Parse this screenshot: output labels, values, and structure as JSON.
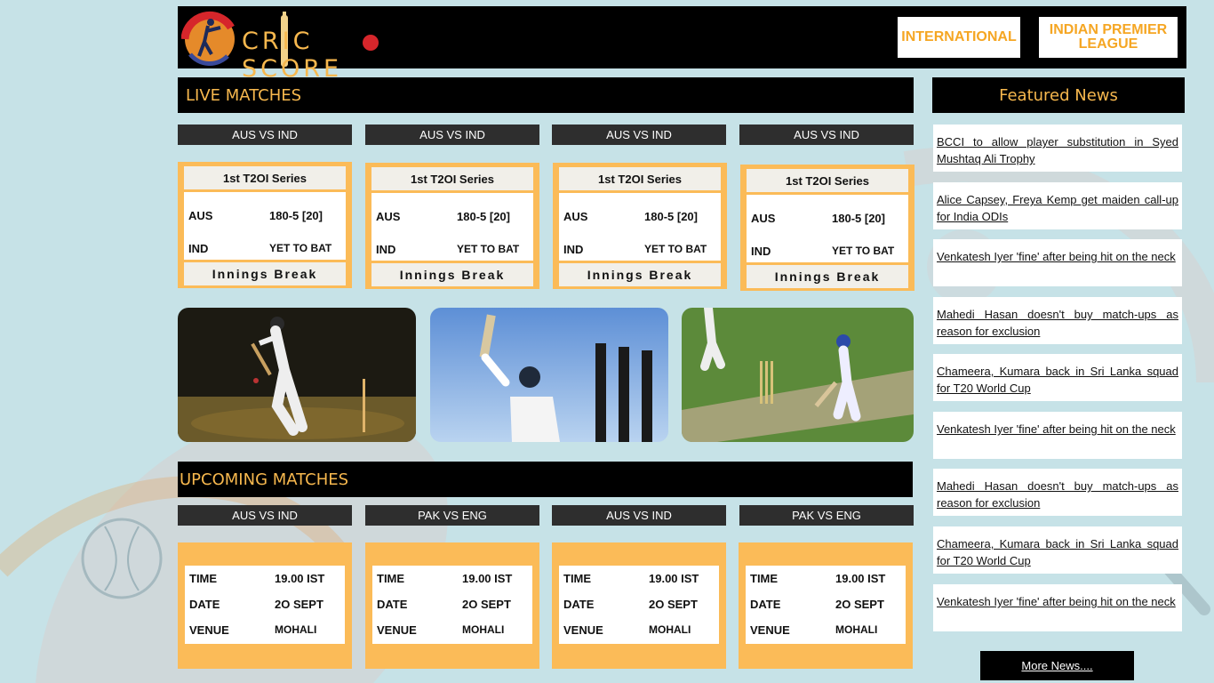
{
  "header": {
    "logo_text": "CRIC SCORE",
    "nav": [
      "INTERNATIONAL",
      "INDIAN PREMIER LEAGUE"
    ]
  },
  "live": {
    "title": "LIVE MATCHES",
    "matches": [
      {
        "teams": "AUS VS IND",
        "series": "1st T2OI Series",
        "team1": "AUS",
        "score1": "180-5 [20]",
        "team2": "IND",
        "score2": "YET TO BAT",
        "status": "Innings Break"
      },
      {
        "teams": "AUS VS IND",
        "series": "1st T2OI Series",
        "team1": "AUS",
        "score1": "180-5 [20]",
        "team2": "IND",
        "score2": "YET TO BAT",
        "status": "Innings Break"
      },
      {
        "teams": "AUS VS IND",
        "series": "1st T2OI Series",
        "team1": "AUS",
        "score1": "180-5 [20]",
        "team2": "IND",
        "score2": "YET TO BAT",
        "status": "Innings Break"
      },
      {
        "teams": "AUS VS IND",
        "series": "1st T2OI Series",
        "team1": "AUS",
        "score1": "180-5 [20]",
        "team2": "IND",
        "score2": "YET TO BAT",
        "status": "Innings Break"
      }
    ]
  },
  "upcoming": {
    "title": "UPCOMING MATCHES",
    "matches": [
      {
        "teams": "AUS VS IND",
        "time_label": "TIME",
        "time": "19.00 IST",
        "date_label": "DATE",
        "date": "2O SEPT",
        "venue_label": "VENUE",
        "venue": "MOHALI"
      },
      {
        "teams": "PAK VS ENG",
        "time_label": "TIME",
        "time": "19.00 IST",
        "date_label": "DATE",
        "date": "2O SEPT",
        "venue_label": "VENUE",
        "venue": "MOHALI"
      },
      {
        "teams": "AUS VS IND",
        "time_label": "TIME",
        "time": "19.00 IST",
        "date_label": "DATE",
        "date": "2O SEPT",
        "venue_label": "VENUE",
        "venue": "MOHALI"
      },
      {
        "teams": "PAK VS ENG",
        "time_label": "TIME",
        "time": "19.00 IST",
        "date_label": "DATE",
        "date": "2O SEPT",
        "venue_label": "VENUE",
        "venue": "MOHALI"
      }
    ]
  },
  "news": {
    "title": "Featured News",
    "items": [
      "BCCI to allow player substitution in Syed Mushtaq Ali Trophy",
      "Alice Capsey, Freya Kemp get maiden call-up for India ODIs",
      "Venkatesh Iyer 'fine' after being hit on the neck",
      "Mahedi Hasan doesn't buy match-ups as reason for exclusion",
      "Chameera, Kumara back in Sri Lanka squad for T20 World Cup",
      "Venkatesh Iyer 'fine' after being hit on the neck",
      "Mahedi Hasan doesn't buy match-ups as reason for exclusion",
      "Chameera, Kumara back in Sri Lanka squad for T20 World Cup",
      "Venkatesh Iyer 'fine' after being hit on the neck"
    ],
    "more": "More News...."
  },
  "colors": {
    "accent": "#f7b84e",
    "card": "#fbbb58",
    "bar": "#000000",
    "background": "#c6e2e7"
  }
}
